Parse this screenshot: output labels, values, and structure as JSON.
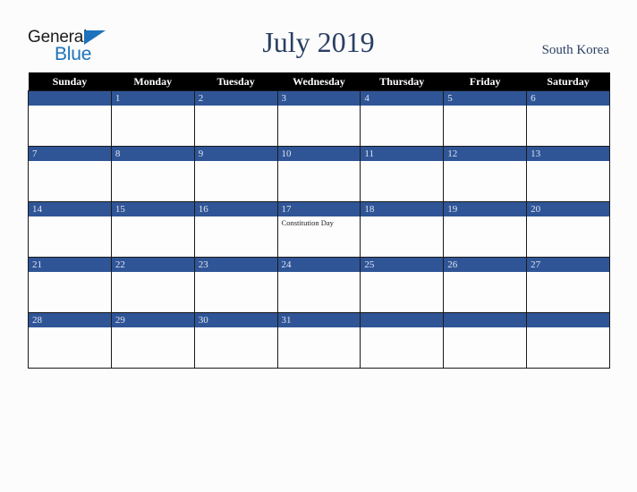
{
  "brand": {
    "name_part1": "General",
    "name_part2": "Blue",
    "triangle_icon": "triangle-icon",
    "color_dark": "#1b1b1b",
    "color_blue": "#1c72bb"
  },
  "header": {
    "title": "July 2019",
    "region": "South Korea",
    "title_color": "#2b3f63"
  },
  "theme": {
    "header_bg": "#000000",
    "header_text": "#ffffff",
    "daynum_bg": "#2f5597",
    "daynum_text": "#dfe5ef",
    "cell_bg": "#fdfdfd",
    "grid_line": "#1a1a1a",
    "page_bg": "#fcfcfc"
  },
  "weekday_headers": [
    "Sunday",
    "Monday",
    "Tuesday",
    "Wednesday",
    "Thursday",
    "Friday",
    "Saturday"
  ],
  "weeks": [
    [
      {
        "day": "",
        "events": []
      },
      {
        "day": "1",
        "events": []
      },
      {
        "day": "2",
        "events": []
      },
      {
        "day": "3",
        "events": []
      },
      {
        "day": "4",
        "events": []
      },
      {
        "day": "5",
        "events": []
      },
      {
        "day": "6",
        "events": []
      }
    ],
    [
      {
        "day": "7",
        "events": []
      },
      {
        "day": "8",
        "events": []
      },
      {
        "day": "9",
        "events": []
      },
      {
        "day": "10",
        "events": []
      },
      {
        "day": "11",
        "events": []
      },
      {
        "day": "12",
        "events": []
      },
      {
        "day": "13",
        "events": []
      }
    ],
    [
      {
        "day": "14",
        "events": []
      },
      {
        "day": "15",
        "events": []
      },
      {
        "day": "16",
        "events": []
      },
      {
        "day": "17",
        "events": [
          "Constitution Day"
        ]
      },
      {
        "day": "18",
        "events": []
      },
      {
        "day": "19",
        "events": []
      },
      {
        "day": "20",
        "events": []
      }
    ],
    [
      {
        "day": "21",
        "events": []
      },
      {
        "day": "22",
        "events": []
      },
      {
        "day": "23",
        "events": []
      },
      {
        "day": "24",
        "events": []
      },
      {
        "day": "25",
        "events": []
      },
      {
        "day": "26",
        "events": []
      },
      {
        "day": "27",
        "events": []
      }
    ],
    [
      {
        "day": "28",
        "events": []
      },
      {
        "day": "29",
        "events": []
      },
      {
        "day": "30",
        "events": []
      },
      {
        "day": "31",
        "events": []
      },
      {
        "day": "",
        "events": []
      },
      {
        "day": "",
        "events": []
      },
      {
        "day": "",
        "events": []
      }
    ]
  ]
}
